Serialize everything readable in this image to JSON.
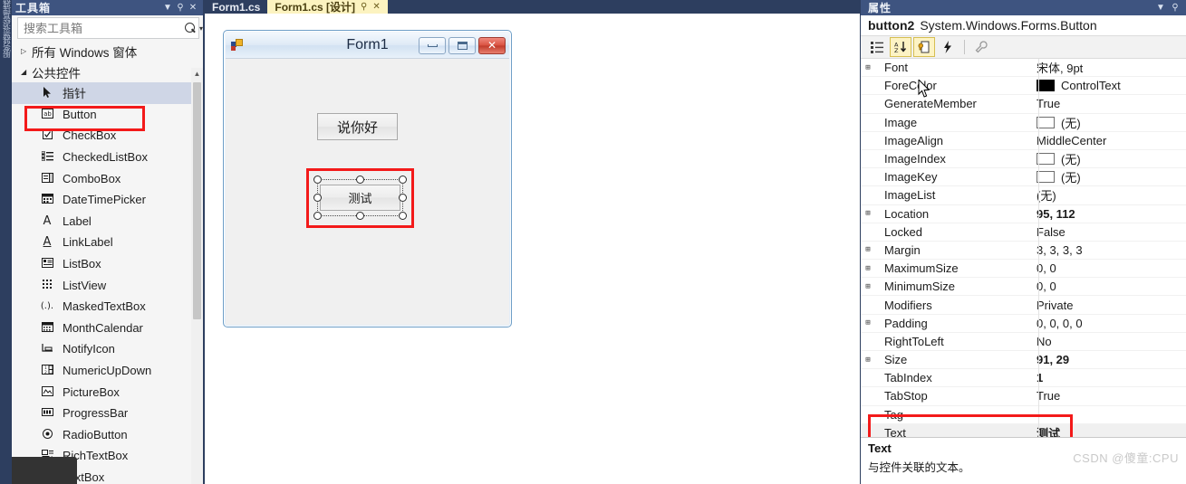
{
  "vertical_strip": {
    "label": "服务器资源管理器"
  },
  "toolbox": {
    "title": "工具箱",
    "header_icons": {
      "dropdown": "▼",
      "pin": "⚲",
      "close": "✕"
    },
    "search": {
      "placeholder": "搜索工具箱",
      "value": "",
      "icon": "search-icon",
      "dropdown": "▾"
    },
    "groups": [
      {
        "label": "所有 Windows 窗体",
        "expanded": false,
        "triangle": "▷"
      },
      {
        "label": "公共控件",
        "expanded": true,
        "triangle": "◢"
      }
    ],
    "items": [
      {
        "label": "指针",
        "icon": "pointer-icon",
        "glyph": "➤",
        "selected": true,
        "highlighted": false
      },
      {
        "label": "Button",
        "icon": "button-icon",
        "glyph": "ab",
        "selected": false,
        "highlighted": true
      },
      {
        "label": "CheckBox",
        "icon": "checkbox-icon",
        "glyph": "☑",
        "selected": false,
        "highlighted": false
      },
      {
        "label": "CheckedListBox",
        "icon": "checkedlistbox-icon",
        "glyph": "≔",
        "selected": false,
        "highlighted": false
      },
      {
        "label": "ComboBox",
        "icon": "combobox-icon",
        "glyph": "▤",
        "selected": false,
        "highlighted": false
      },
      {
        "label": "DateTimePicker",
        "icon": "datetimepicker-icon",
        "glyph": "▦",
        "selected": false,
        "highlighted": false
      },
      {
        "label": "Label",
        "icon": "label-icon",
        "glyph": "A",
        "selected": false,
        "highlighted": false
      },
      {
        "label": "LinkLabel",
        "icon": "linklabel-icon",
        "glyph": "A",
        "selected": false,
        "highlighted": false
      },
      {
        "label": "ListBox",
        "icon": "listbox-icon",
        "glyph": "▣",
        "selected": false,
        "highlighted": false
      },
      {
        "label": "ListView",
        "icon": "listview-icon",
        "glyph": "⣿",
        "selected": false,
        "highlighted": false
      },
      {
        "label": "MaskedTextBox",
        "icon": "maskedtextbox-icon",
        "glyph": "(.).",
        "selected": false,
        "highlighted": false
      },
      {
        "label": "MonthCalendar",
        "icon": "monthcalendar-icon",
        "glyph": "▦",
        "selected": false,
        "highlighted": false
      },
      {
        "label": "NotifyIcon",
        "icon": "notifyicon-icon",
        "glyph": "⊾",
        "selected": false,
        "highlighted": false
      },
      {
        "label": "NumericUpDown",
        "icon": "numericupdown-icon",
        "glyph": "⇳",
        "selected": false,
        "highlighted": false
      },
      {
        "label": "PictureBox",
        "icon": "picturebox-icon",
        "glyph": "⛰",
        "selected": false,
        "highlighted": false
      },
      {
        "label": "ProgressBar",
        "icon": "progressbar-icon",
        "glyph": "▥",
        "selected": false,
        "highlighted": false
      },
      {
        "label": "RadioButton",
        "icon": "radiobutton-icon",
        "glyph": "◉",
        "selected": false,
        "highlighted": false
      },
      {
        "label": "RichTextBox",
        "icon": "richtextbox-icon",
        "glyph": "▤",
        "selected": false,
        "highlighted": false
      },
      {
        "label": "TextBox",
        "icon": "textbox-icon",
        "glyph": "ab",
        "selected": false,
        "highlighted": false
      }
    ],
    "scroll": {
      "up_arrow": "▲"
    }
  },
  "editor": {
    "tabs": [
      {
        "label": "Form1.cs",
        "active": false
      },
      {
        "label": "Form1.cs [设计]",
        "active": true,
        "pin": "⚲",
        "close": "✕"
      }
    ]
  },
  "form_designer": {
    "window": {
      "title": "Form1",
      "icon": "form-icon",
      "buttons": [
        {
          "name": "minimize-button",
          "glyph": "—"
        },
        {
          "name": "maximize-button",
          "glyph": "❐"
        },
        {
          "name": "close-button",
          "glyph": "✕"
        }
      ]
    },
    "controls": [
      {
        "name": "button1",
        "text": "说你好",
        "selected": false
      },
      {
        "name": "button2",
        "text": "测试",
        "selected": true
      }
    ]
  },
  "properties": {
    "title": "属性",
    "header_icons": {
      "dropdown": "▼",
      "pin": "⚲"
    },
    "object_name": "button2",
    "object_type": "System.Windows.Forms.Button",
    "toolbar": [
      {
        "name": "categorized-button",
        "glyph": "▤",
        "active": false,
        "dim": false
      },
      {
        "name": "alphabetical-sort-button",
        "glyph": "A↓",
        "active": true,
        "dim": false
      },
      {
        "name": "properties-page-button",
        "glyph": "🗎",
        "active": true,
        "dim": false,
        "highlighted": true
      },
      {
        "name": "events-button",
        "glyph": "⚡",
        "active": false,
        "dim": false
      },
      {
        "name": "property-pages-button",
        "glyph": "🔧",
        "active": false,
        "dim": true
      }
    ],
    "rows": [
      {
        "name": "Font",
        "value": "宋体, 9pt",
        "expandable": true,
        "bold": false,
        "swatch": null
      },
      {
        "name": "ForeColor",
        "value": "ControlText",
        "expandable": false,
        "bold": false,
        "swatch": "black"
      },
      {
        "name": "GenerateMember",
        "value": "True",
        "expandable": false,
        "bold": false,
        "swatch": null
      },
      {
        "name": "Image",
        "value": "(无)",
        "expandable": false,
        "bold": false,
        "swatch": "white"
      },
      {
        "name": "ImageAlign",
        "value": "MiddleCenter",
        "expandable": false,
        "bold": false,
        "swatch": null
      },
      {
        "name": "ImageIndex",
        "value": "(无)",
        "expandable": false,
        "bold": false,
        "swatch": "white"
      },
      {
        "name": "ImageKey",
        "value": "(无)",
        "expandable": false,
        "bold": false,
        "swatch": "white"
      },
      {
        "name": "ImageList",
        "value": "(无)",
        "expandable": false,
        "bold": false,
        "swatch": null
      },
      {
        "name": "Location",
        "value": "95, 112",
        "expandable": true,
        "bold": true,
        "swatch": null
      },
      {
        "name": "Locked",
        "value": "False",
        "expandable": false,
        "bold": false,
        "swatch": null
      },
      {
        "name": "Margin",
        "value": "3, 3, 3, 3",
        "expandable": true,
        "bold": false,
        "swatch": null
      },
      {
        "name": "MaximumSize",
        "value": "0, 0",
        "expandable": true,
        "bold": false,
        "swatch": null
      },
      {
        "name": "MinimumSize",
        "value": "0, 0",
        "expandable": true,
        "bold": false,
        "swatch": null
      },
      {
        "name": "Modifiers",
        "value": "Private",
        "expandable": false,
        "bold": false,
        "swatch": null
      },
      {
        "name": "Padding",
        "value": "0, 0, 0, 0",
        "expandable": true,
        "bold": false,
        "swatch": null
      },
      {
        "name": "RightToLeft",
        "value": "No",
        "expandable": false,
        "bold": false,
        "swatch": null
      },
      {
        "name": "Size",
        "value": "91, 29",
        "expandable": true,
        "bold": true,
        "swatch": null
      },
      {
        "name": "TabIndex",
        "value": "1",
        "expandable": false,
        "bold": true,
        "swatch": null
      },
      {
        "name": "TabStop",
        "value": "True",
        "expandable": false,
        "bold": false,
        "swatch": null
      },
      {
        "name": "Tag",
        "value": "",
        "expandable": false,
        "bold": false,
        "swatch": null
      },
      {
        "name": "Text",
        "value": "测试",
        "expandable": false,
        "bold": true,
        "swatch": null,
        "selected": true
      }
    ],
    "description": {
      "title": "Text",
      "text": "与控件关联的文本。"
    }
  },
  "watermark": "CSDN @傻童:CPU",
  "colors": {
    "accent": "#2d3e5f",
    "panel_header": "#3e5480",
    "highlight_red": "#f31a1a",
    "active_tab": "#fcf3c0"
  }
}
